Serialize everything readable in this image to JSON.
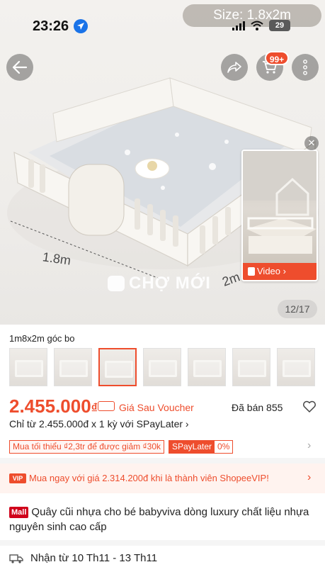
{
  "status_bar": {
    "time": "23:26",
    "battery": "29"
  },
  "header": {
    "size_label": "Size: 1.8x2m",
    "cart_badge": "99+"
  },
  "image": {
    "dimension_width": "1.8m",
    "dimension_depth": "2m",
    "watermark": "CHỢ MỚI",
    "counter": "12/17"
  },
  "video": {
    "label": "Video",
    "close": "✕"
  },
  "variant": {
    "title": "1m8x2m góc bo",
    "thumbnails": [
      {
        "name": "variant-thumb-1",
        "selected": false
      },
      {
        "name": "variant-thumb-2",
        "selected": false
      },
      {
        "name": "variant-thumb-3",
        "selected": true
      },
      {
        "name": "variant-thumb-4",
        "selected": false
      },
      {
        "name": "variant-thumb-5",
        "selected": false
      },
      {
        "name": "variant-thumb-6",
        "selected": false
      },
      {
        "name": "variant-thumb-7",
        "selected": false
      }
    ]
  },
  "pricing": {
    "price": "2.455.000",
    "currency": "₫",
    "price_label": "Giá Sau Voucher",
    "sold": "Đã bán 855",
    "spaylater_line": "Chỉ từ 2.455.000đ x 1 kỳ với SPayLater",
    "promo_tag": "Mua tối thiểu ₫2,3tr để được giảm ₫30k",
    "spay_tag_label": "SPayLater",
    "spay_tag_value": "0%"
  },
  "vip": {
    "badge": "VIP",
    "text": "Mua ngay với giá 2.314.200đ khi là thành viên ShopeeVIP!"
  },
  "product": {
    "mall_badge": "Mall",
    "title": "Quây cũi nhựa cho bé babyviva dòng luxury chất liệu nhựa nguyên sinh cao cấp"
  },
  "delivery": {
    "text": "Nhận từ 10 Th11 - 13 Th11"
  },
  "colors": {
    "accent": "#ee4d2d",
    "mall": "#d0011b"
  }
}
